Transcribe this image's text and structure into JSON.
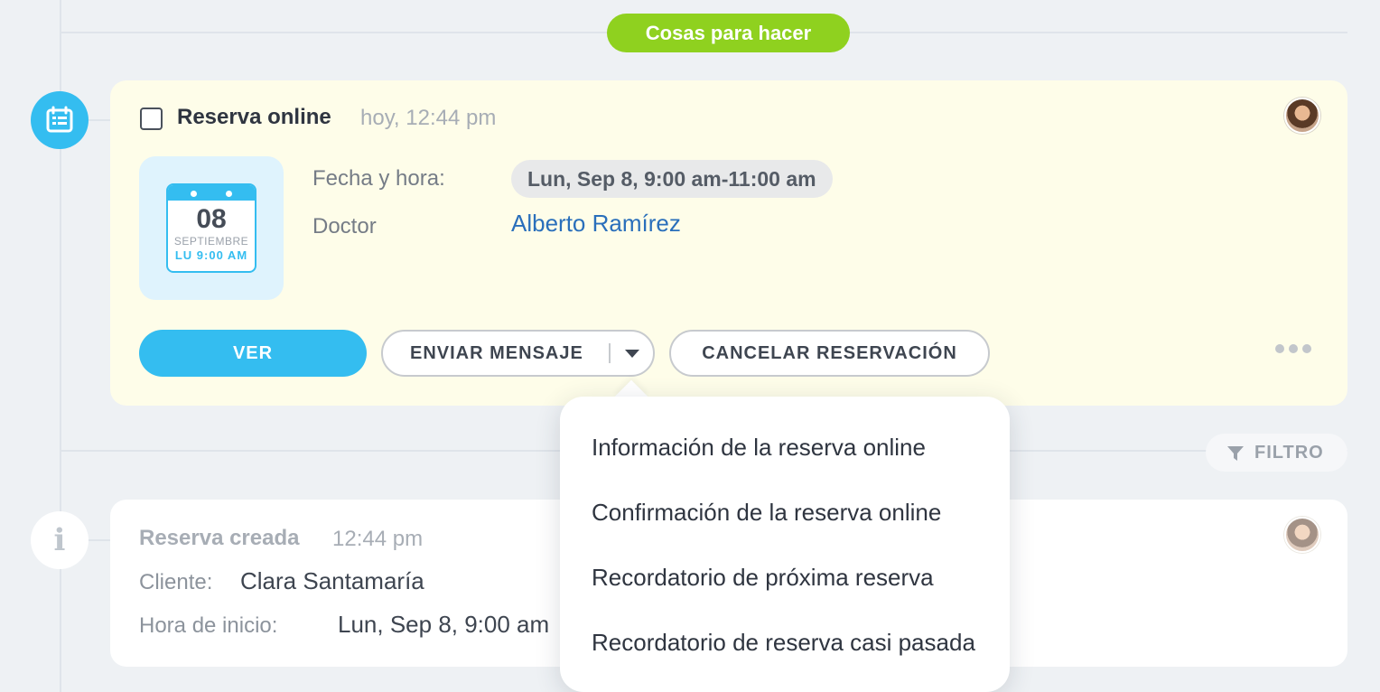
{
  "section": {
    "label": "Cosas para hacer"
  },
  "todo": {
    "title": "Reserva online",
    "time": "hoy, 12:44 pm",
    "calendar": {
      "day": "08",
      "month": "SEPTIEMBRE",
      "weekday_time": "LU 9:00 AM"
    },
    "fields": {
      "date_label": "Fecha y hora:",
      "date_value": "Lun, Sep 8, 9:00 am-11:00 am",
      "doctor_label": "Doctor",
      "doctor_value": "Alberto Ramírez"
    },
    "buttons": {
      "view": "VER",
      "send_message": "ENVIAR MENSAJE",
      "cancel": "CANCELAR RESERVACIÓN"
    }
  },
  "filter": {
    "label": "FILTRO"
  },
  "log": {
    "title": "Reserva creada",
    "time": "12:44 pm",
    "client_label": "Cliente:",
    "client_value": "Clara Santamaría",
    "start_label": "Hora de inicio:",
    "start_value": "Lun, Sep 8, 9:00 am"
  },
  "dropdown": {
    "items": [
      {
        "label": "Información de la reserva online"
      },
      {
        "label": "Confirmación de la reserva online"
      },
      {
        "label": "Recordatorio de próxima reserva"
      },
      {
        "label": "Recordatorio de reserva casi pasada"
      }
    ]
  },
  "colors": {
    "accent": "#34bdf0",
    "section_pill": "#8fd11f",
    "todo_card_bg": "#fefde9",
    "link": "#2a6fbb"
  },
  "icons": {
    "timeline_booking": "calendar-list-icon",
    "timeline_info": "info-icon",
    "filter": "filter-funnel-icon",
    "more": "more-dots-icon",
    "dropdown": "caret-down-icon"
  }
}
